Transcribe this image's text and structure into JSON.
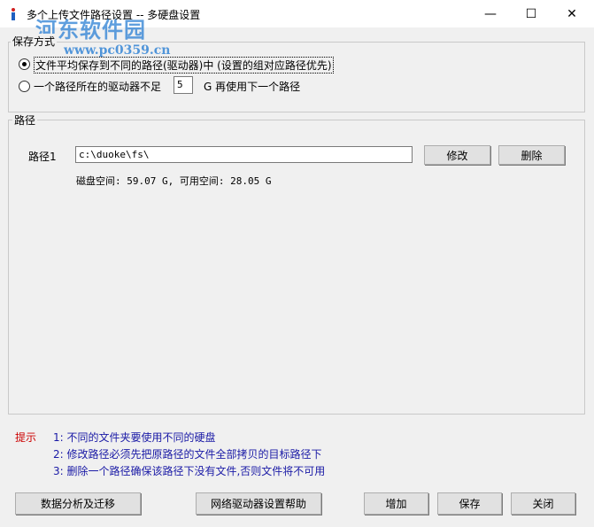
{
  "window": {
    "title": "多个上传文件路径设置 -- 多硬盘设置",
    "watermark": "河东软件园",
    "watermark_url": "www.pc0359.cn",
    "controls": {
      "minimize": "—",
      "maximize": "☐",
      "close": "✕"
    }
  },
  "save_mode": {
    "group_title": "保存方式",
    "option1_label": "文件平均保存到不同的路径(驱动器)中  (设置的组对应路径优先)",
    "option1_checked": true,
    "option2_prefix": "一个路径所在的驱动器不足",
    "option2_value": "5",
    "option2_suffix": "G 再使用下一个路径",
    "option2_checked": false
  },
  "path": {
    "group_title": "路径",
    "label": "路径1",
    "value": "c:\\duoke\\fs\\",
    "modify_button": "修改",
    "delete_button": "删除",
    "disk_info": "磁盘空间: 59.07 G, 可用空间: 28.05 G"
  },
  "tips": {
    "label": "提示",
    "items": [
      "1: 不同的文件夹要使用不同的硬盘",
      "2: 修改路径必须先把原路径的文件全部拷贝的目标路径下",
      "3: 删除一个路径确保该路径下没有文件,否则文件将不可用"
    ]
  },
  "footer": {
    "analyze_button": "数据分析及迁移",
    "network_help_button": "网络驱动器设置帮助",
    "add_button": "增加",
    "save_button": "保存",
    "close_button": "关闭"
  },
  "colors": {
    "tip_label": "#cc0000",
    "tip_text": "#1a1aa6",
    "watermark": "#2a7fd4"
  }
}
